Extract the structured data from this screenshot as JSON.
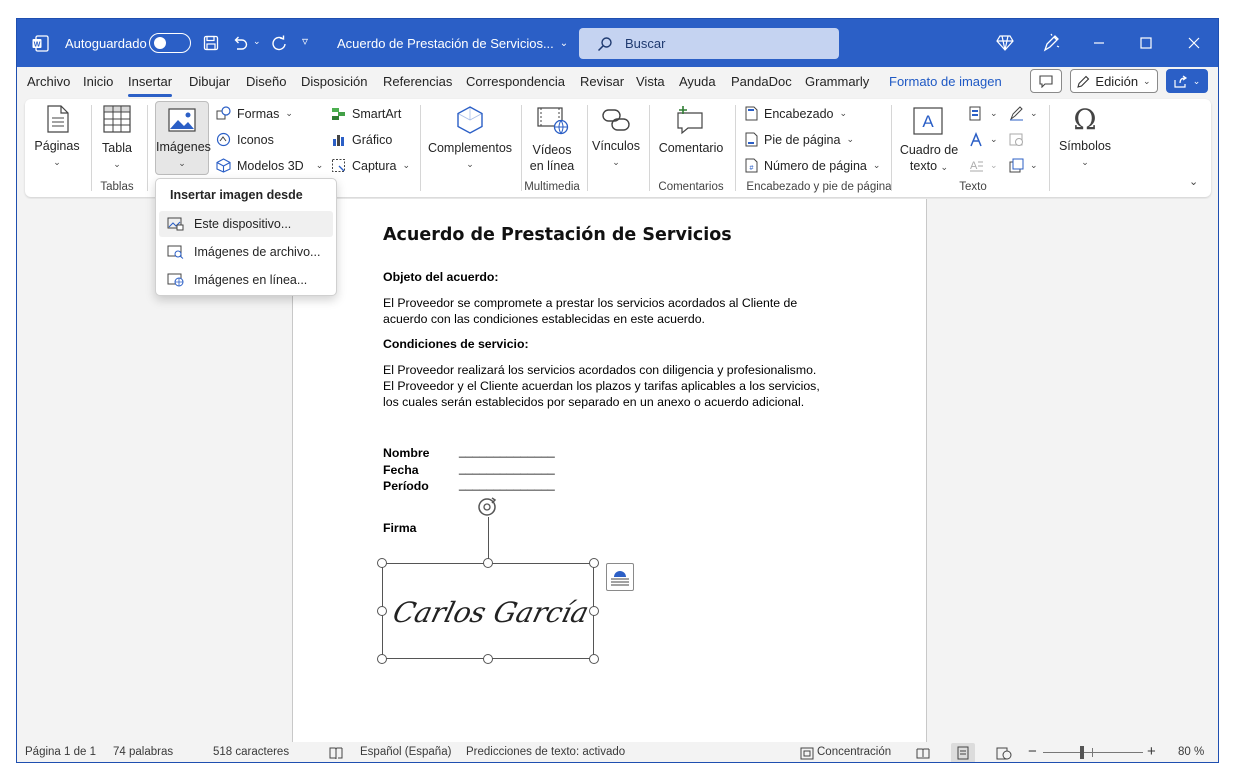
{
  "titlebar": {
    "autosave_label": "Autoguardado",
    "doc_title": "Acuerdo de Prestación de Servicios...",
    "search_placeholder": "Buscar",
    "bg_color": "#2b5fc6"
  },
  "menubar": {
    "items": [
      "Archivo",
      "Inicio",
      "Insertar",
      "Dibujar",
      "Diseño",
      "Disposición",
      "Referencias",
      "Correspondencia",
      "Revisar",
      "Vista",
      "Ayuda",
      "PandaDoc",
      "Grammarly",
      "Formato de imagen"
    ],
    "active": "Insertar",
    "edit_mode": "Edición"
  },
  "ribbon": {
    "paginas": "Páginas",
    "tabla": "Tabla",
    "imagenes": "Imágenes",
    "formas": "Formas",
    "iconos": "Iconos",
    "modelos3d": "Modelos 3D",
    "smartart": "SmartArt",
    "grafico": "Gráfico",
    "captura": "Captura",
    "complementos": "Complementos",
    "videos_l1": "Vídeos",
    "videos_l2": "en línea",
    "vinculos": "Vínculos",
    "comentario": "Comentario",
    "encabezado": "Encabezado",
    "pie": "Pie de página",
    "numero": "Número de página",
    "cuadro_l1": "Cuadro de",
    "cuadro_l2": "texto",
    "simbolos": "Símbolos",
    "groups": {
      "tablas": "Tablas",
      "multimedia": "Multimedia",
      "comentarios": "Comentarios",
      "encabezado_pie": "Encabezado y pie de página",
      "texto": "Texto"
    }
  },
  "dropdown": {
    "header": "Insertar imagen desde",
    "items": [
      "Este dispositivo...",
      "Imágenes de archivo...",
      "Imágenes en línea..."
    ]
  },
  "document": {
    "title": "Acuerdo de Prestación de Servicios",
    "h1": "Objeto del acuerdo:",
    "p1_l1": "El Proveedor se compromete a prestar los servicios acordados al Cliente de",
    "p1_l2": "acuerdo con las condiciones establecidas en este acuerdo.",
    "h2": "Condiciones de servicio:",
    "p2_l1": "El Proveedor realizará los servicios acordados con diligencia y profesionalismo.",
    "p2_l2": "El Proveedor y el Cliente acuerdan los plazos y tarifas aplicables a los servicios,",
    "p2_l3": "los cuales serán establecidos por separado en un anexo o acuerdo adicional.",
    "fields": [
      {
        "label": "Nombre",
        "value": "______________"
      },
      {
        "label": "Fecha",
        "value": "______________"
      },
      {
        "label": "Período",
        "value": "______________"
      }
    ],
    "firma": "Firma",
    "signature": "Carlos García"
  },
  "statusbar": {
    "page": "Página 1 de 1",
    "words": "74 palabras",
    "chars": "518 caracteres",
    "language": "Español (España)",
    "predictions": "Predicciones de texto: activado",
    "focus": "Concentración",
    "zoom": "80 %"
  }
}
